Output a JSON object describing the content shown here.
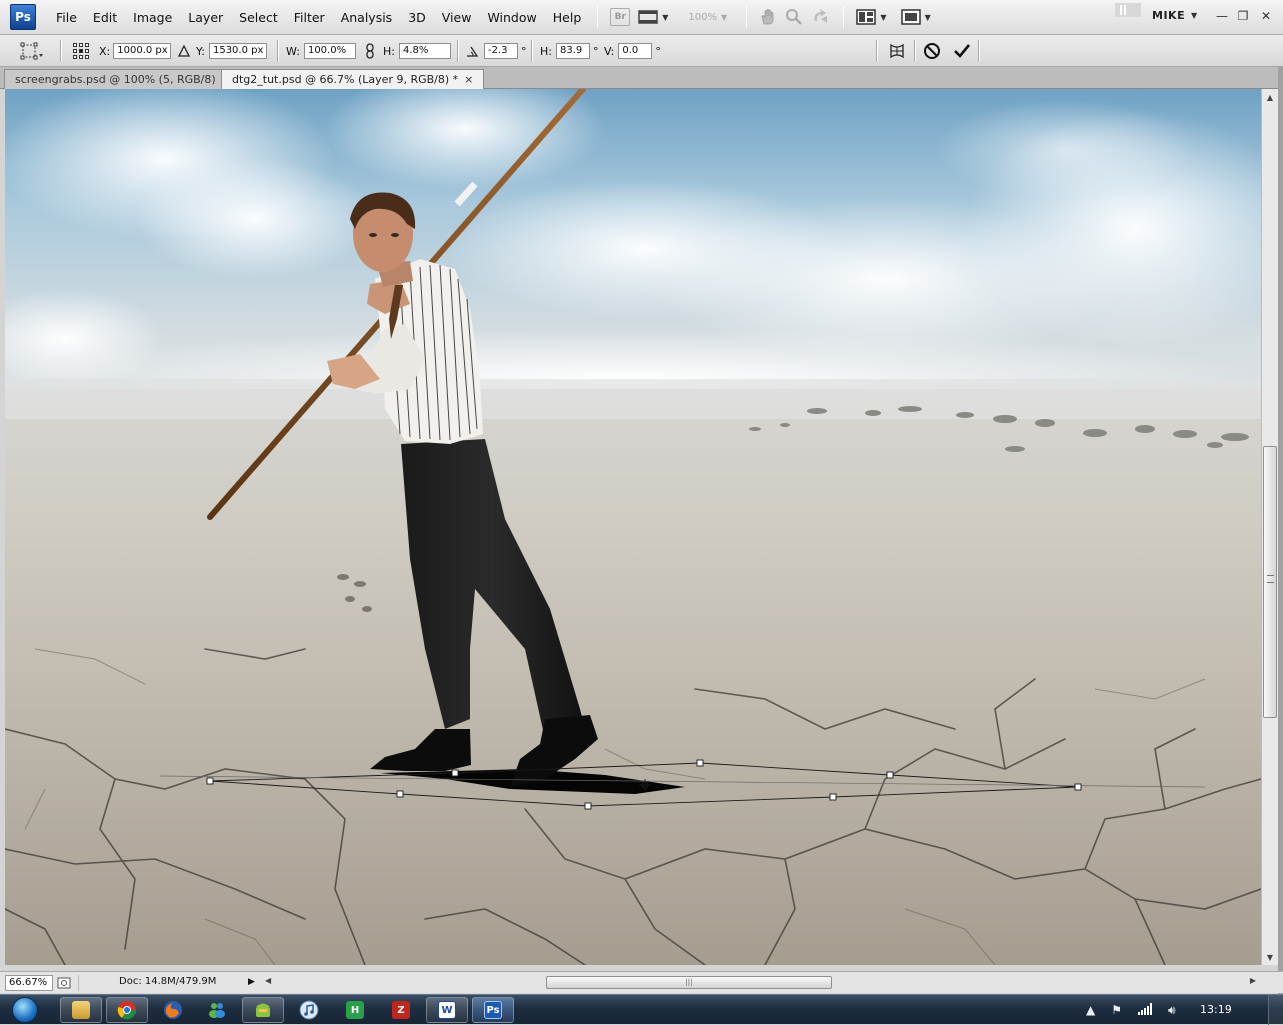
{
  "app": {
    "logo": "Ps"
  },
  "menu": [
    "File",
    "Edit",
    "Image",
    "Layer",
    "Select",
    "Filter",
    "Analysis",
    "3D",
    "View",
    "Window",
    "Help"
  ],
  "app_bar": {
    "bridge_label": "Br",
    "zoom_value": "100%",
    "workspace": "MIKE"
  },
  "options": {
    "x_label": "X:",
    "x_value": "1000.0 px",
    "y_label": "Y:",
    "y_value": "1530.0 px",
    "w_label": "W:",
    "w_value": "100.0%",
    "h_label": "H:",
    "h_value": "4.8%",
    "rotate_value": "-2.3",
    "hskew_label": "H:",
    "hskew_value": "83.9",
    "vskew_label": "V:",
    "vskew_value": "0.0",
    "degree": "°"
  },
  "tabs": [
    {
      "label": "screengrabs.psd @ 100% (5, RGB/8)",
      "close": "×",
      "active": false
    },
    {
      "label": "dtg2_tut.psd @ 66.7% (Layer 9, RGB/8) *",
      "close": "×",
      "active": true
    }
  ],
  "status": {
    "zoom": "66.67%",
    "doc_info": "Doc: 14.8M/479.9M",
    "hscroll_grip": "|||"
  },
  "taskbar": {
    "clock": "13:19"
  },
  "icons": {
    "hand": "hand-tool-icon",
    "zoom": "zoom-tool-icon",
    "rotate": "rotate-view-icon",
    "arrange": "arrange-documents-icon",
    "screen": "screen-mode-icon",
    "cancel": "cancel-transform-icon",
    "commit": "commit-transform-icon",
    "warp": "warp-mode-icon",
    "link": "link-proportions-icon"
  },
  "colors": {
    "menubar": "#e6e6e6",
    "taskbar": "#1e2e40",
    "ps_blue": "#1f5bb5",
    "sky": "#8fb9d6",
    "ground": "#cfc8bb"
  }
}
